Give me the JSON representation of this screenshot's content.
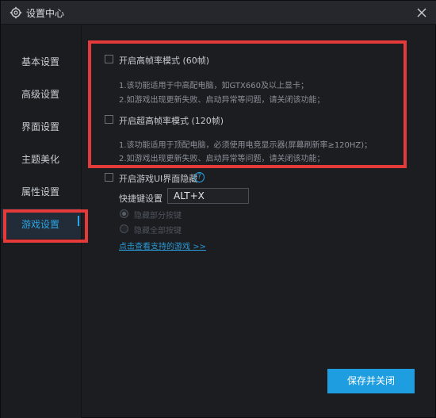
{
  "window": {
    "title": "设置中心"
  },
  "sidebar": {
    "items": [
      {
        "label": "基本设置"
      },
      {
        "label": "高级设置"
      },
      {
        "label": "界面设置"
      },
      {
        "label": "主题美化"
      },
      {
        "label": "属性设置"
      },
      {
        "label": "游戏设置",
        "active": true
      }
    ]
  },
  "game": {
    "option1": {
      "label": "开启高帧率模式 (60帧)",
      "line1": "1.该功能适用于中高配电脑，如GTX660及以上显卡；",
      "line2": "2.如游戏出现更新失败、启动异常等问题，请关闭该功能；"
    },
    "option2": {
      "label": "开启超高帧率模式 (120帧)",
      "line1": "1.该功能适用于顶配电脑，必须使用电竞显示器(屏幕刷新率≥120HZ)；",
      "line2": "2.如游戏出现更新失败、启动异常等问题，请关闭该功能；"
    },
    "option3": {
      "label": "开启游戏UI界面隐藏",
      "help": "?"
    },
    "hotkey": {
      "label": "快捷键设置",
      "value": "ALT+X"
    },
    "radio1": "隐藏部分按键",
    "radio2": "隐藏全部按键",
    "link": "点击查看支持的游戏 >>"
  },
  "footer": {
    "save_label": "保存并关闭"
  },
  "colors": {
    "accent": "#1e9ee0",
    "highlight": "#e53a3a"
  }
}
